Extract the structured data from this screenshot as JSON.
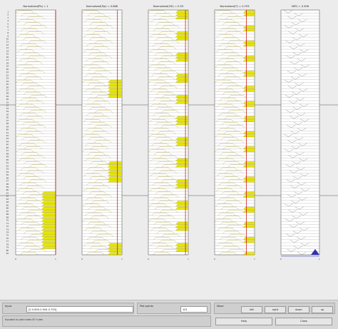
{
  "panels": [
    {
      "title": "Normalized(Pb) = 1"
    },
    {
      "title": "Normalized(Ppi) = 0.888"
    },
    {
      "title": "Normalized(VSi) = 0.93"
    },
    {
      "title": "Normalized(T) = 0.793"
    },
    {
      "title": "NPCI = 0.396"
    }
  ],
  "controls": {
    "input_label": "Input",
    "input_value": "[0 0.894 0.944 0.793]",
    "plot_points_label": "Plot points",
    "plot_points_value": "101",
    "move_label": "Move",
    "buttons": {
      "left": "left",
      "right": "right",
      "down": "down",
      "up": "up",
      "help": "Help",
      "close": "Close"
    },
    "status_text": "Inputed in plot index 67 rules"
  },
  "colors": {
    "fill": "#e6e600",
    "cursor": "#cc0000",
    "npci_line": "#3030b0"
  },
  "chart_data": {
    "type": "rule-viewer",
    "rule_count": 81,
    "columns": 5,
    "active_rule": 81
  }
}
